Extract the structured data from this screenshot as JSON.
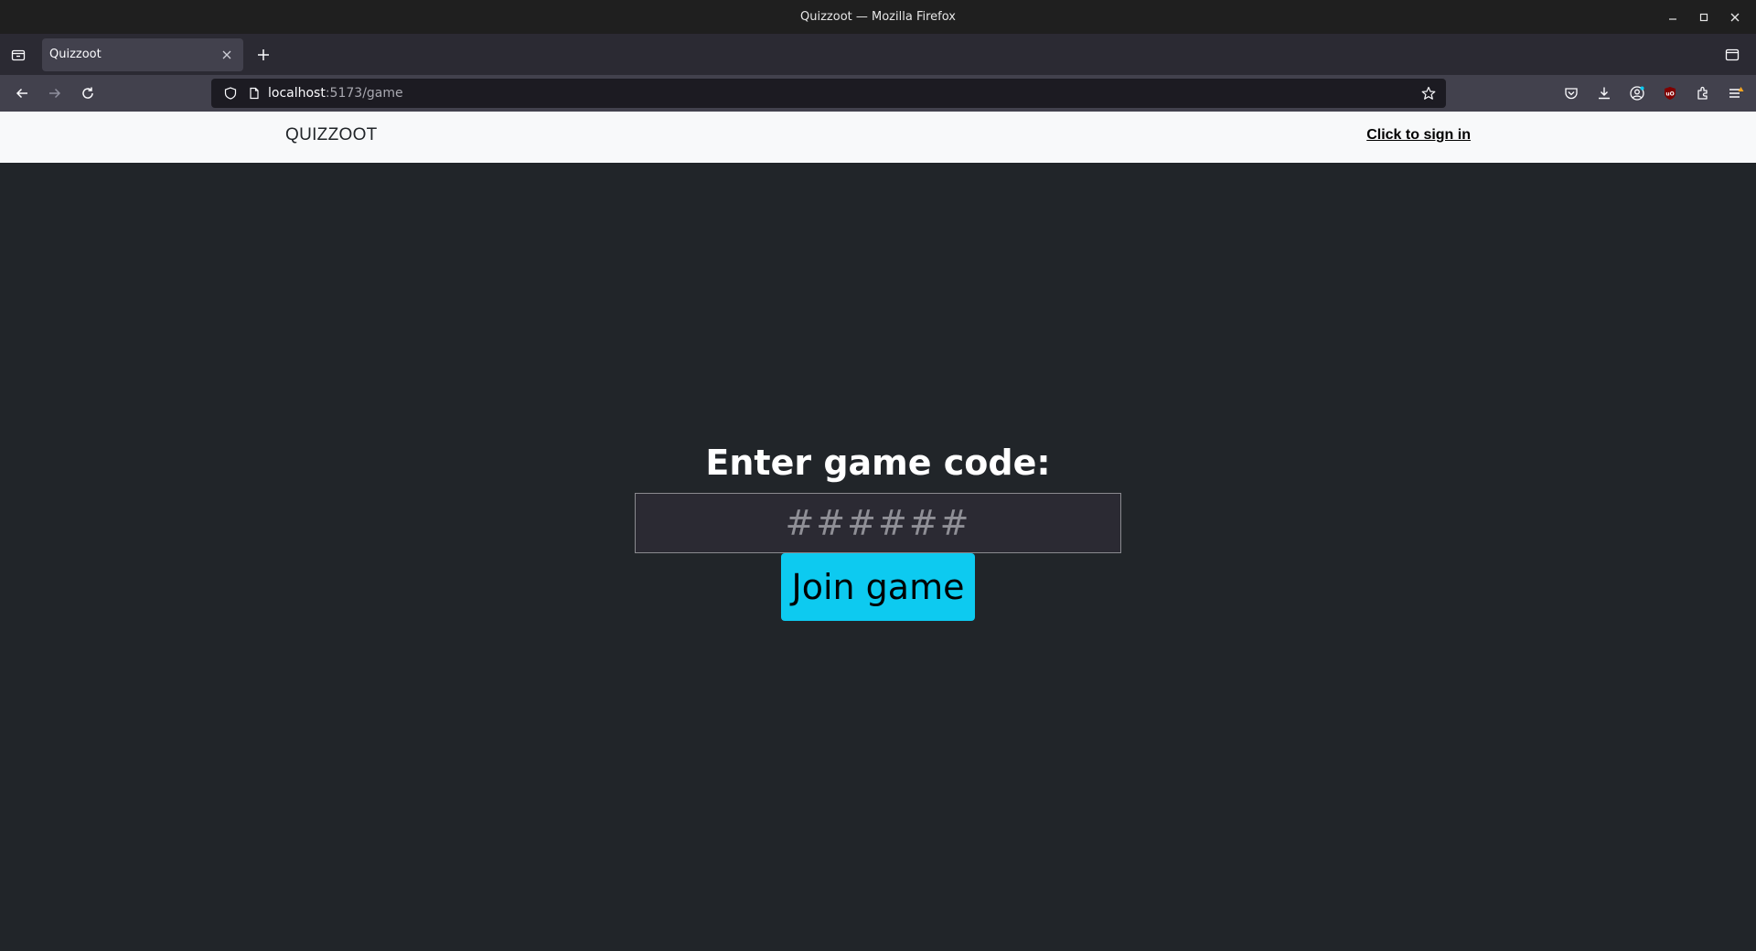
{
  "window": {
    "title": "Quizzoot — Mozilla Firefox",
    "controls": [
      "minimize-icon",
      "maximize-icon",
      "close-icon"
    ]
  },
  "tabs": [
    {
      "label": "Quizzoot",
      "active": true
    }
  ],
  "navbar": {
    "url_host": "localhost",
    "url_path": ":5173/game"
  },
  "app": {
    "brand": "QUIZZOOT",
    "signin_label": "Click to sign in",
    "heading": "Enter game code:",
    "code_placeholder": "######",
    "code_value": "",
    "join_label": "Join game"
  },
  "colors": {
    "page_bg": "#212529",
    "nav_bg": "#f8f9fa",
    "accent": "#0dcaf0"
  }
}
